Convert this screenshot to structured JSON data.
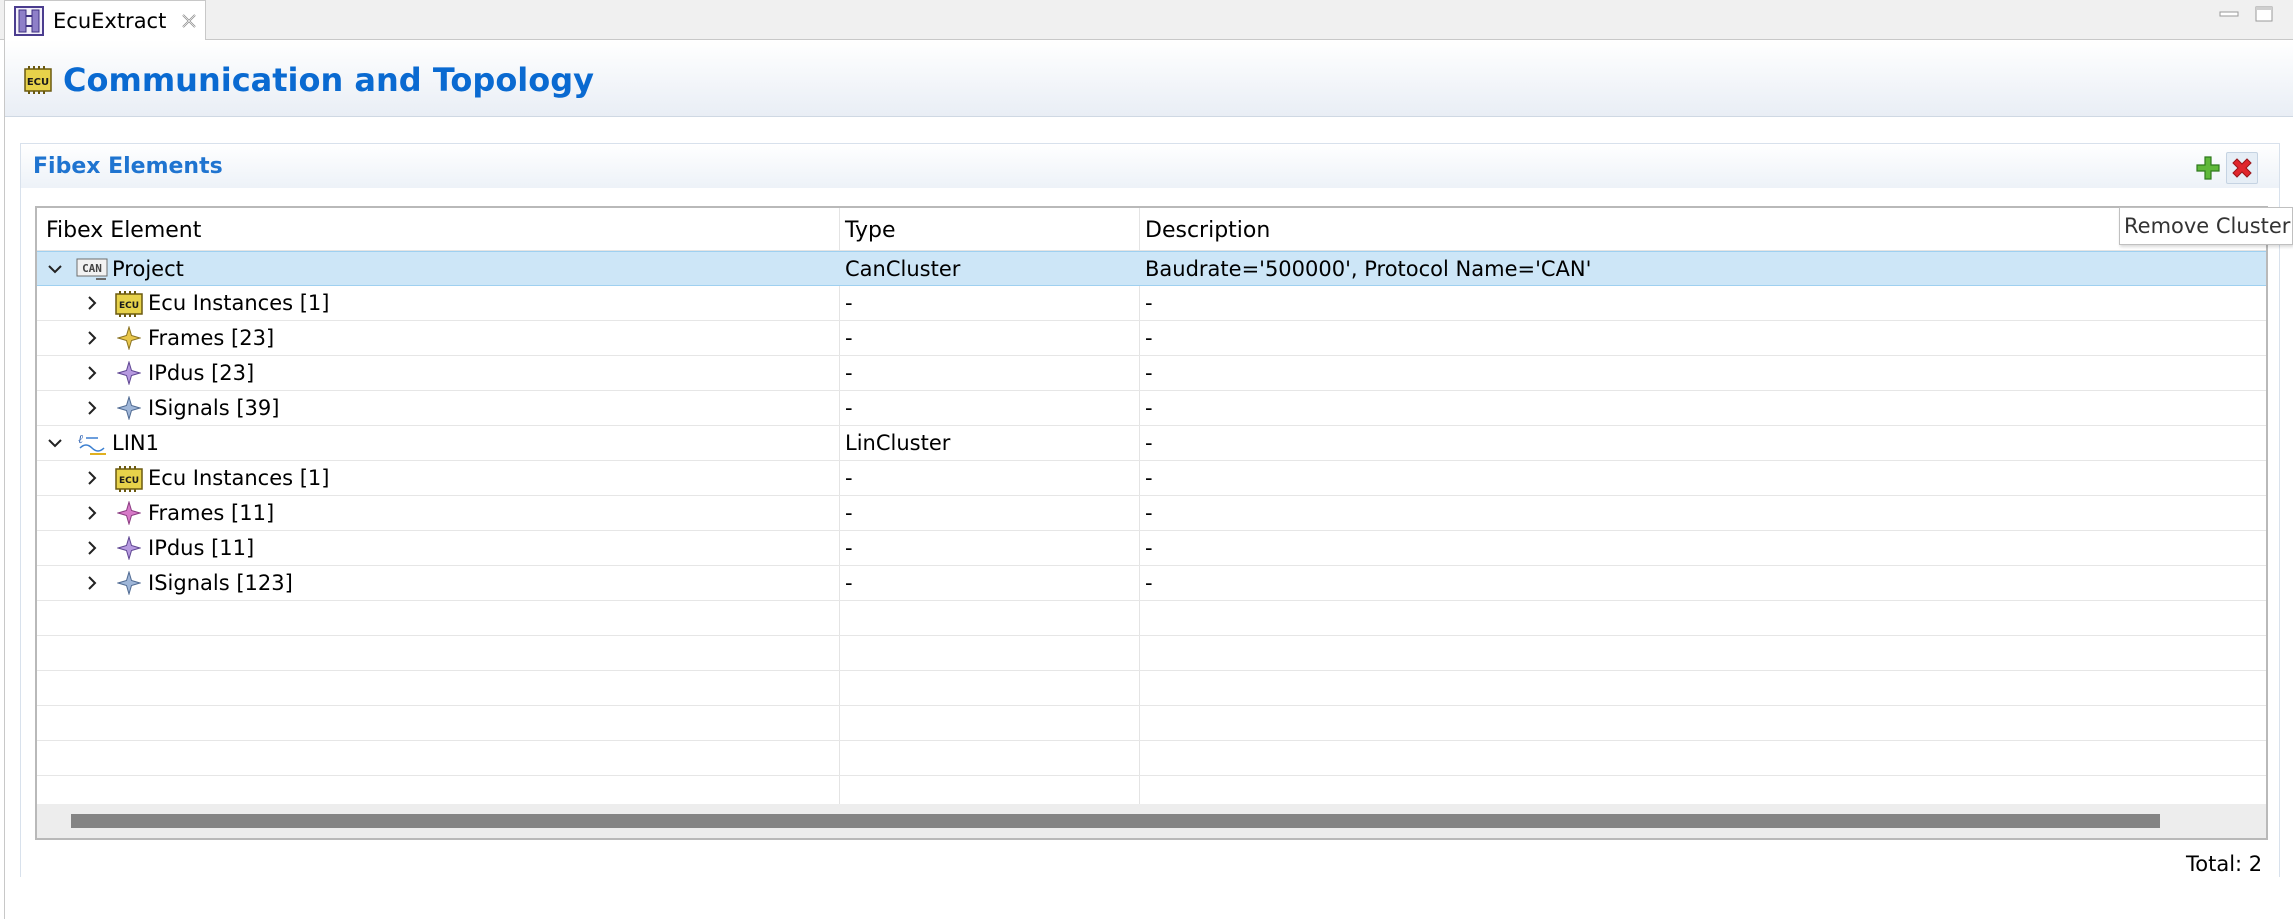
{
  "tab": {
    "label": "EcuExtract",
    "icon": "ecu-extract-icon"
  },
  "window_controls": [
    "minimize-icon",
    "maximize-icon"
  ],
  "form": {
    "title": "Communication and Topology",
    "icon": "ecu-chip-icon"
  },
  "section": {
    "title": "Fibex Elements",
    "actions": {
      "add": "add-icon",
      "remove": "remove-icon"
    }
  },
  "table": {
    "columns": [
      "Fibex Element",
      "Type",
      "Description"
    ],
    "rows": [
      {
        "name": "Project",
        "type": "CanCluster",
        "description": "Baudrate='500000', Protocol Name='CAN'",
        "icon": "can-cluster-icon",
        "level": 0,
        "expanded": true,
        "selected": true
      },
      {
        "name": "Ecu Instances [1]",
        "type": "-",
        "description": "-",
        "icon": "ecu-chip-icon",
        "level": 1,
        "expanded": false
      },
      {
        "name": "Frames [23]",
        "type": "-",
        "description": "-",
        "icon": "frame-star-icon",
        "level": 1,
        "expanded": false
      },
      {
        "name": "IPdus [23]",
        "type": "-",
        "description": "-",
        "icon": "ipdu-star-icon",
        "level": 1,
        "expanded": false
      },
      {
        "name": "ISignals [39]",
        "type": "-",
        "description": "-",
        "icon": "isignal-star-icon",
        "level": 1,
        "expanded": false
      },
      {
        "name": "LIN1",
        "type": "LinCluster",
        "description": "-",
        "icon": "lin-cluster-icon",
        "level": 0,
        "expanded": true
      },
      {
        "name": "Ecu Instances [1]",
        "type": "-",
        "description": "-",
        "icon": "ecu-chip-icon",
        "level": 1,
        "expanded": false
      },
      {
        "name": "Frames [11]",
        "type": "-",
        "description": "-",
        "icon": "frame-star-icon",
        "level": 1,
        "expanded": false
      },
      {
        "name": "IPdus [11]",
        "type": "-",
        "description": "-",
        "icon": "ipdu-star-icon",
        "level": 1,
        "expanded": false
      },
      {
        "name": "ISignals [123]",
        "type": "-",
        "description": "-",
        "icon": "isignal-star-icon",
        "level": 1,
        "expanded": false
      }
    ]
  },
  "tooltip": "Remove Cluster",
  "footer": {
    "total": "Total: 2"
  },
  "colors": {
    "title_blue": "#0a6ad1",
    "selection": "#cde6f7",
    "add_green": "#3a9a2a",
    "remove_red": "#d9262c"
  }
}
